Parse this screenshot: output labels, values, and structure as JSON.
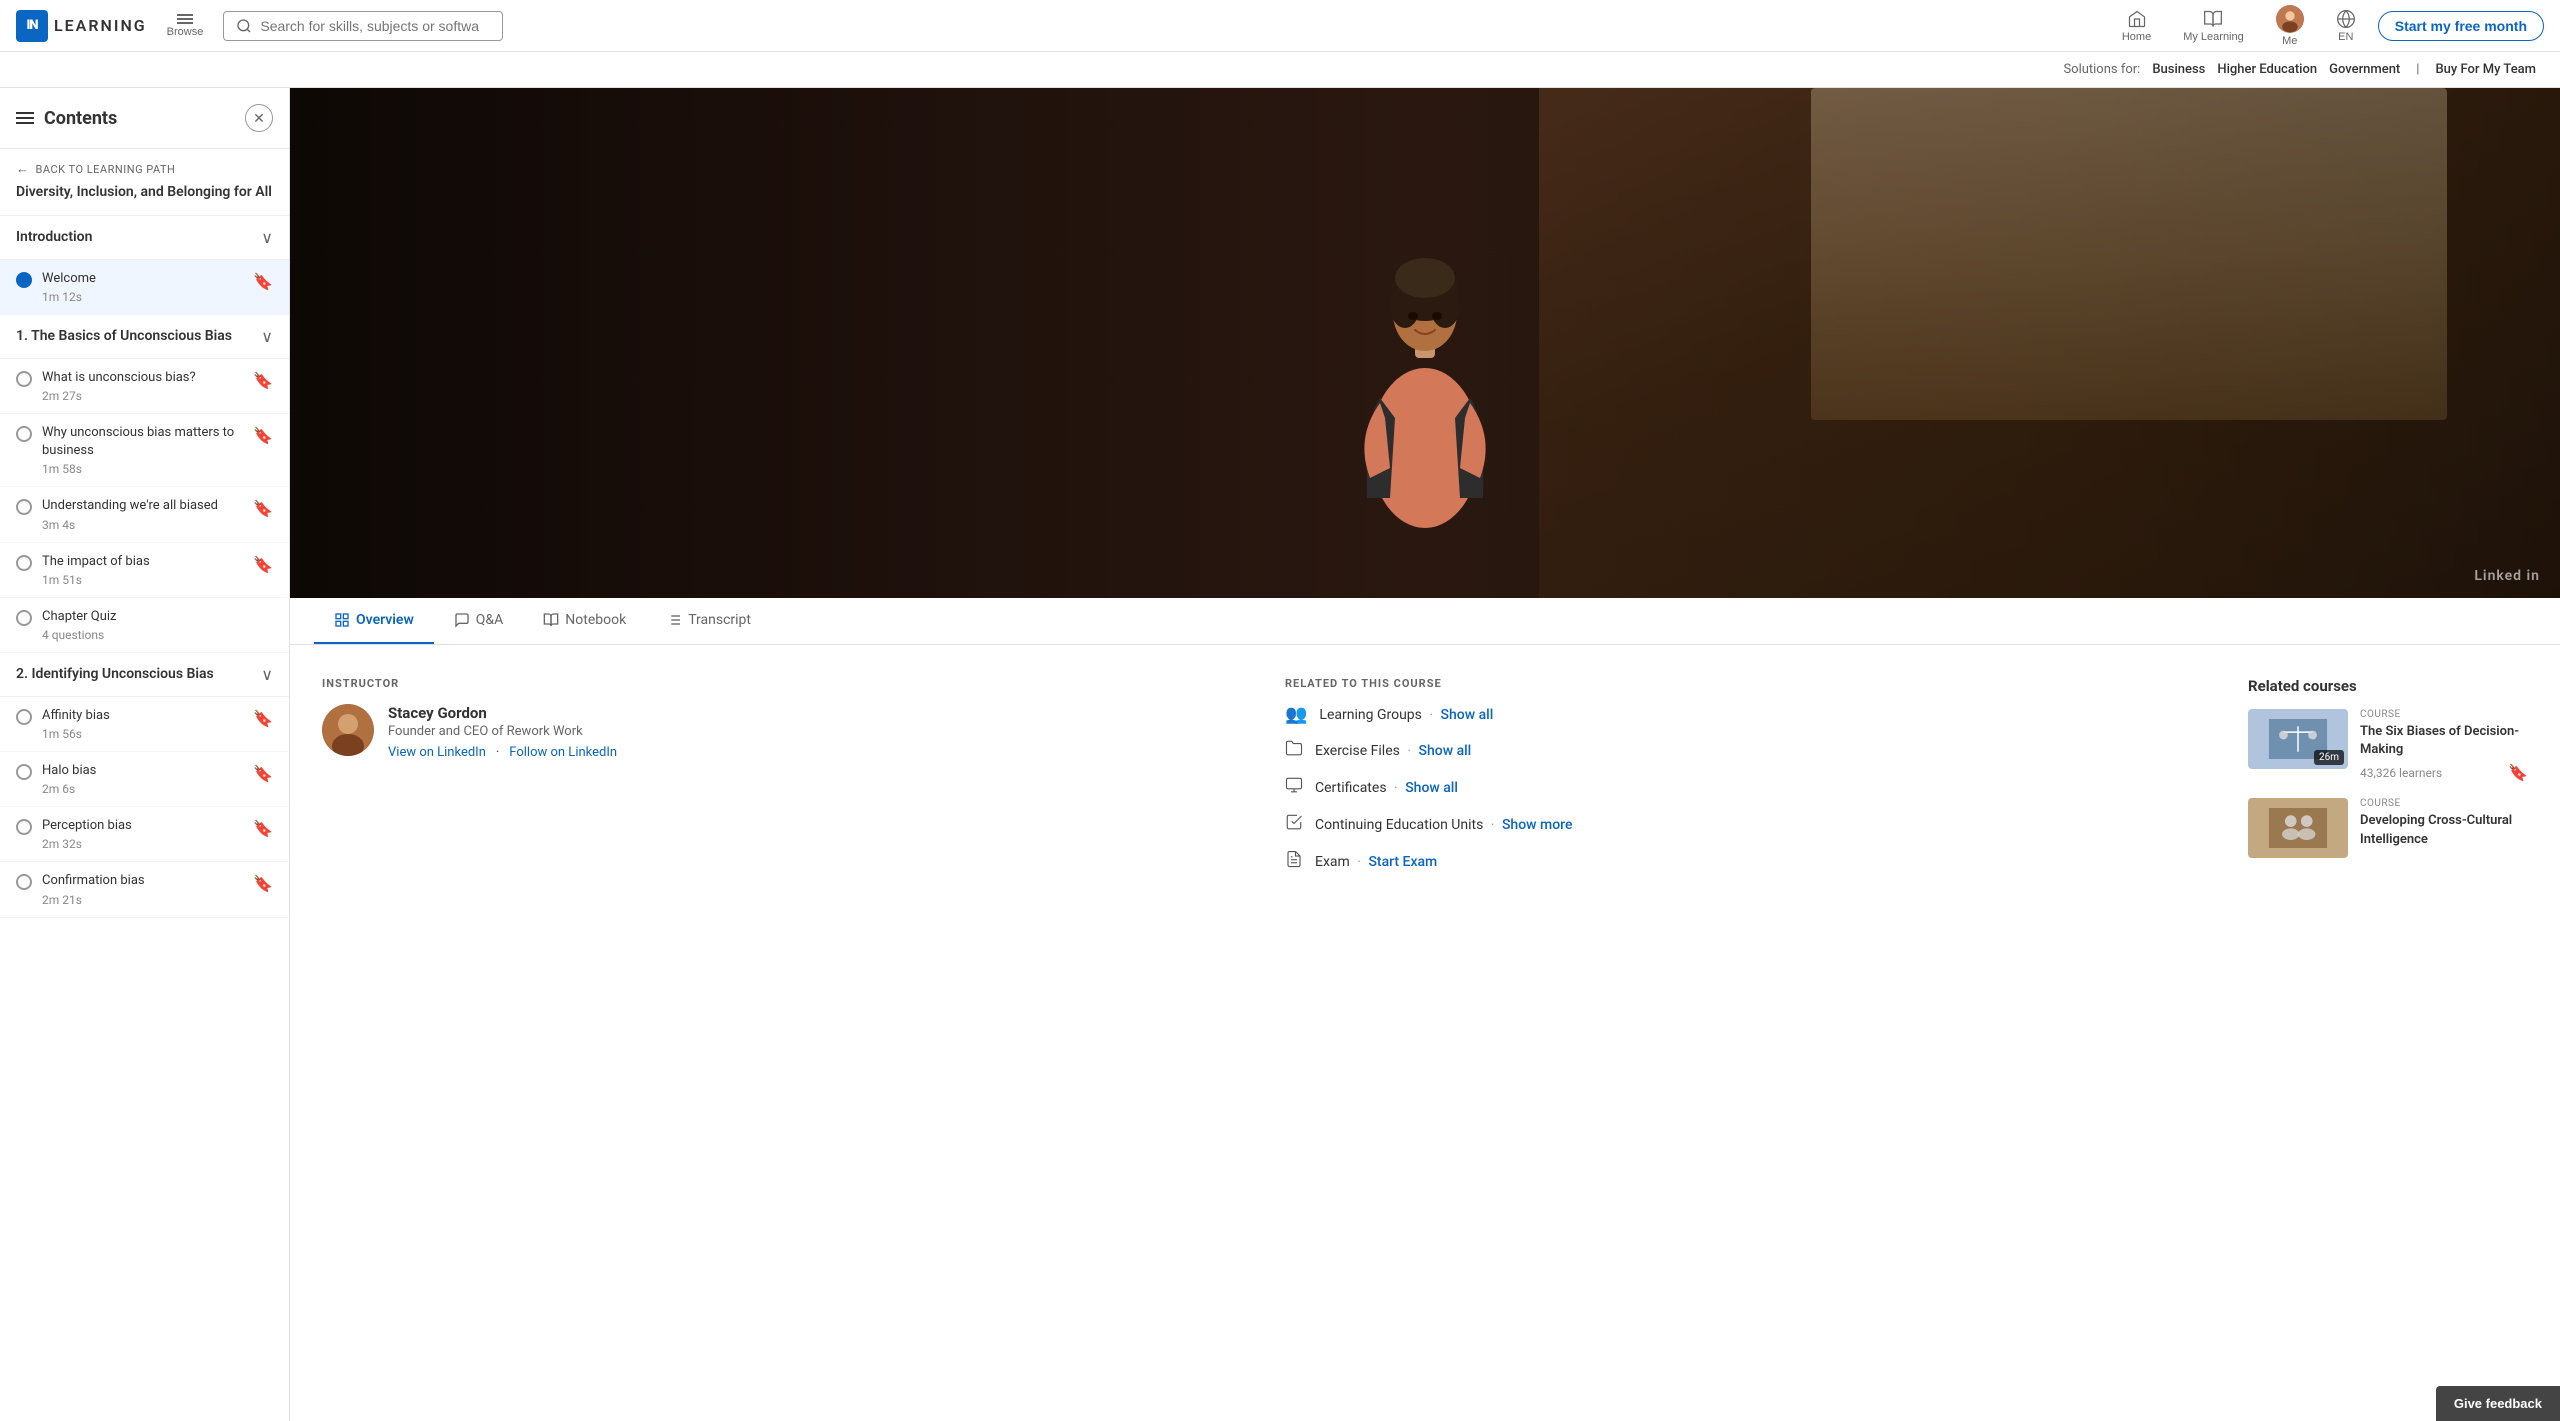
{
  "nav": {
    "logo_in": "IN",
    "logo_text": "LEARNING",
    "browse_label": "Browse",
    "search_placeholder": "Search for skills, subjects or software",
    "home_label": "Home",
    "my_learning_label": "My Learning",
    "me_label": "Me",
    "lang_label": "EN",
    "cta_label": "Start my free month",
    "solutions_label": "Solutions for:",
    "solutions_items": [
      "Business",
      "Higher Education",
      "Government"
    ],
    "buy_label": "Buy For My Team"
  },
  "sidebar": {
    "title": "Contents",
    "back_label": "BACK TO LEARNING PATH",
    "course_title": "Diversity, Inclusion, and Belonging for All",
    "sections": [
      {
        "label": "Introduction",
        "expanded": true,
        "lessons": [
          {
            "title": "Welcome",
            "duration": "1m 12s",
            "active": true,
            "filled": true
          }
        ]
      },
      {
        "label": "1. The Basics of Unconscious Bias",
        "expanded": true,
        "lessons": [
          {
            "title": "What is unconscious bias?",
            "duration": "2m 27s",
            "active": false,
            "filled": false
          },
          {
            "title": "Why unconscious bias matters to business",
            "duration": "1m 58s",
            "active": false,
            "filled": false
          },
          {
            "title": "Understanding we're all biased",
            "duration": "3m 4s",
            "active": false,
            "filled": false
          },
          {
            "title": "The impact of bias",
            "duration": "1m 51s",
            "active": false,
            "filled": false
          },
          {
            "title": "Chapter Quiz",
            "duration": "4 questions",
            "active": false,
            "filled": false
          }
        ]
      },
      {
        "label": "2. Identifying Unconscious Bias",
        "expanded": true,
        "lessons": [
          {
            "title": "Affinity bias",
            "duration": "1m 56s",
            "active": false,
            "filled": false
          },
          {
            "title": "Halo bias",
            "duration": "2m 6s",
            "active": false,
            "filled": false
          },
          {
            "title": "Perception bias",
            "duration": "2m 32s",
            "active": false,
            "filled": false
          },
          {
            "title": "Confirmation bias",
            "duration": "2m 21s",
            "active": false,
            "filled": false
          }
        ]
      }
    ]
  },
  "tabs": [
    {
      "label": "Overview",
      "icon": "grid-icon",
      "active": true
    },
    {
      "label": "Q&A",
      "icon": "chat-icon",
      "active": false
    },
    {
      "label": "Notebook",
      "icon": "notebook-icon",
      "active": false
    },
    {
      "label": "Transcript",
      "icon": "list-icon",
      "active": false
    }
  ],
  "instructor": {
    "label": "INSTRUCTOR",
    "name": "Stacey Gordon",
    "role": "Founder and CEO of Rework Work",
    "view_link": "View on LinkedIn",
    "follow_link": "Follow on LinkedIn"
  },
  "related": {
    "label": "RELATED TO THIS COURSE",
    "items": [
      {
        "icon": "👥",
        "text": "Learning Groups",
        "action": "Show all"
      },
      {
        "icon": "📁",
        "text": "Exercise Files",
        "action": "Show all"
      },
      {
        "icon": "🎓",
        "text": "Certificates",
        "action": "Show all"
      },
      {
        "icon": "📋",
        "text": "Continuing Education Units",
        "action": "Show more"
      },
      {
        "icon": "📝",
        "text": "Exam",
        "action": "Start Exam",
        "action_type": "start"
      }
    ]
  },
  "related_courses": {
    "title": "Related courses",
    "courses": [
      {
        "type": "COURSE",
        "title": "The Six Biases of Decision-Making",
        "duration": "26m",
        "learners": "43,326 learners",
        "thumb_color": "#b0c4de"
      },
      {
        "type": "COURSE",
        "title": "Developing Cross-Cultural Intelligence",
        "duration": "",
        "learners": "",
        "thumb_color": "#c4a882"
      }
    ]
  },
  "linkedin_watermark": "Linked in",
  "give_feedback_label": "Give feedback"
}
